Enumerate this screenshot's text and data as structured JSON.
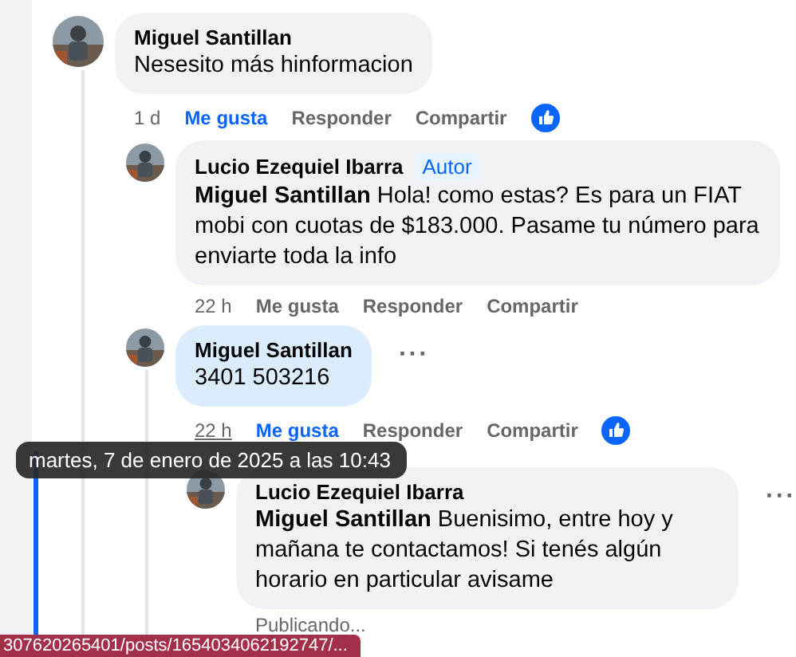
{
  "comments": [
    {
      "author": "Miguel Santillan",
      "text": "Nesesito más hinformacion",
      "highlight": false,
      "time": "1 d",
      "time_underlined": false,
      "liked": true,
      "actions": [
        "Me gusta",
        "Responder",
        "Compartir"
      ],
      "children": [
        {
          "author": "Lucio Ezequiel Ibarra",
          "badge": "Autor",
          "mention": "Miguel Santillan",
          "text": "Hola! como estas? Es para un FIAT mobi con cuotas de $183.000. Pasame tu número para enviarte toda la info",
          "highlight": false,
          "time": "22 h",
          "time_underlined": false,
          "liked": false,
          "actions": [
            "Me gusta",
            "Responder",
            "Compartir"
          ]
        },
        {
          "author": "Miguel Santillan",
          "text": "3401 503216",
          "highlight": true,
          "time": "22 h",
          "time_underlined": true,
          "liked": true,
          "actions": [
            "Me gusta",
            "Responder",
            "Compartir"
          ],
          "more": "···",
          "children": [
            {
              "author": "Lucio Ezequiel Ibarra",
              "mention": "Miguel Santillan",
              "text": "Buenisimo, entre hoy y mañana te contactamos! Si tenés algún horario en particular avisame",
              "highlight": false,
              "status": "Publicando...",
              "more": "···"
            }
          ]
        }
      ]
    }
  ],
  "tooltip": "martes, 7 de enero de 2025 a las 10:43",
  "status_bar": "307620265401/posts/1654034062192747/..."
}
